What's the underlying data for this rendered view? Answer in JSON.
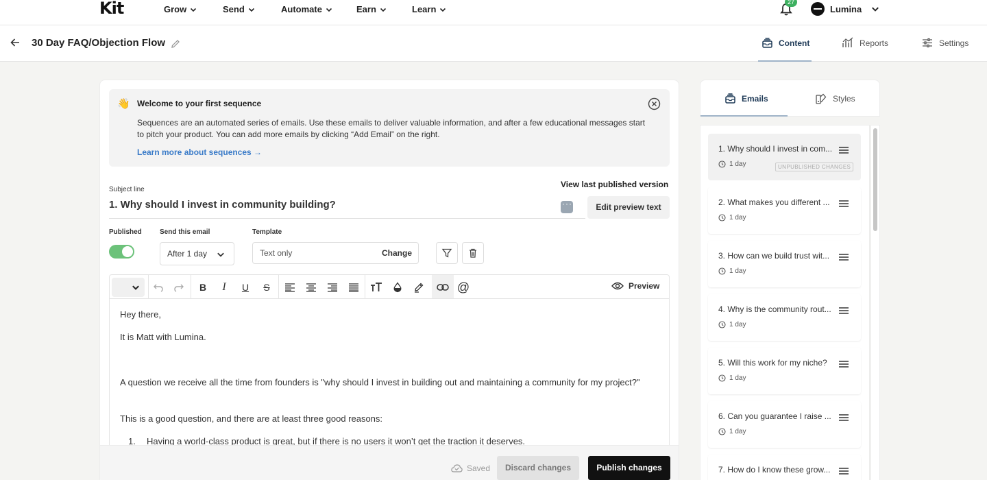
{
  "nav": {
    "logo": "Kit",
    "items": [
      {
        "label": "Grow"
      },
      {
        "label": "Send"
      },
      {
        "label": "Automate"
      },
      {
        "label": "Earn"
      },
      {
        "label": "Learn"
      }
    ],
    "notifications_count": "27",
    "account_name": "Lumina"
  },
  "header": {
    "title": "30 Day FAQ/Objection Flow",
    "tabs": [
      {
        "label": "Content",
        "icon": "inbox-stack-icon",
        "active": true
      },
      {
        "label": "Reports",
        "icon": "chart-icon",
        "active": false
      },
      {
        "label": "Settings",
        "icon": "sliders-icon",
        "active": false
      }
    ]
  },
  "welcome": {
    "emoji": "👋",
    "title": "Welcome to your first sequence",
    "body": "Sequences are an automated series of emails. Use these emails to deliver valuable information, and after a few educational messages start to pitch your product. You can add more emails by clicking “Add Email” on the right.",
    "link": "Learn more about sequences →"
  },
  "email_editor": {
    "subject_label": "Subject line",
    "subject": "1. Why should I invest in community building?",
    "view_last_published": "View last published version",
    "edit_preview_text": "Edit preview text",
    "published_label": "Published",
    "published": true,
    "send_label": "Send this email",
    "send_value": "After 1 day",
    "template_label": "Template",
    "template_value": "Text only",
    "template_change": "Change",
    "preview_label": "Preview",
    "body": [
      "Hey there,",
      "It is Matt with Lumina.",
      "A question we receive all the time from founders is \"why should I invest in building out and maintaining a community for my project?\"",
      "This is a good question, and there are at least three good reasons:",
      "Having a world-class product is great, but if there is no users it won’t get the traction it deserves."
    ],
    "list_marker": "1.",
    "saved_label": "Saved",
    "discard_label": "Discard changes",
    "publish_label": "Publish changes"
  },
  "sidebar": {
    "tabs": [
      {
        "label": "Emails",
        "active": true
      },
      {
        "label": "Styles",
        "active": false
      }
    ],
    "emails": [
      {
        "title": "1. Why should I invest in com...",
        "delay": "1 day",
        "badge": "UNPUBLISHED CHANGES"
      },
      {
        "title": "2. What makes you different ...",
        "delay": "1 day"
      },
      {
        "title": "3. How can we build trust wit...",
        "delay": "1 day"
      },
      {
        "title": "4. Why is the community rout...",
        "delay": "1 day"
      },
      {
        "title": "5. Will this work for my niche?",
        "delay": "1 day"
      },
      {
        "title": "6. Can you guarantee I raise ...",
        "delay": "1 day"
      },
      {
        "title": "7. How do I know these grow...",
        "delay": ""
      }
    ]
  },
  "colors": {
    "accent_green": "#6cc27a",
    "link_blue": "#3a7bc8",
    "active_tab": "#1f3a57"
  }
}
